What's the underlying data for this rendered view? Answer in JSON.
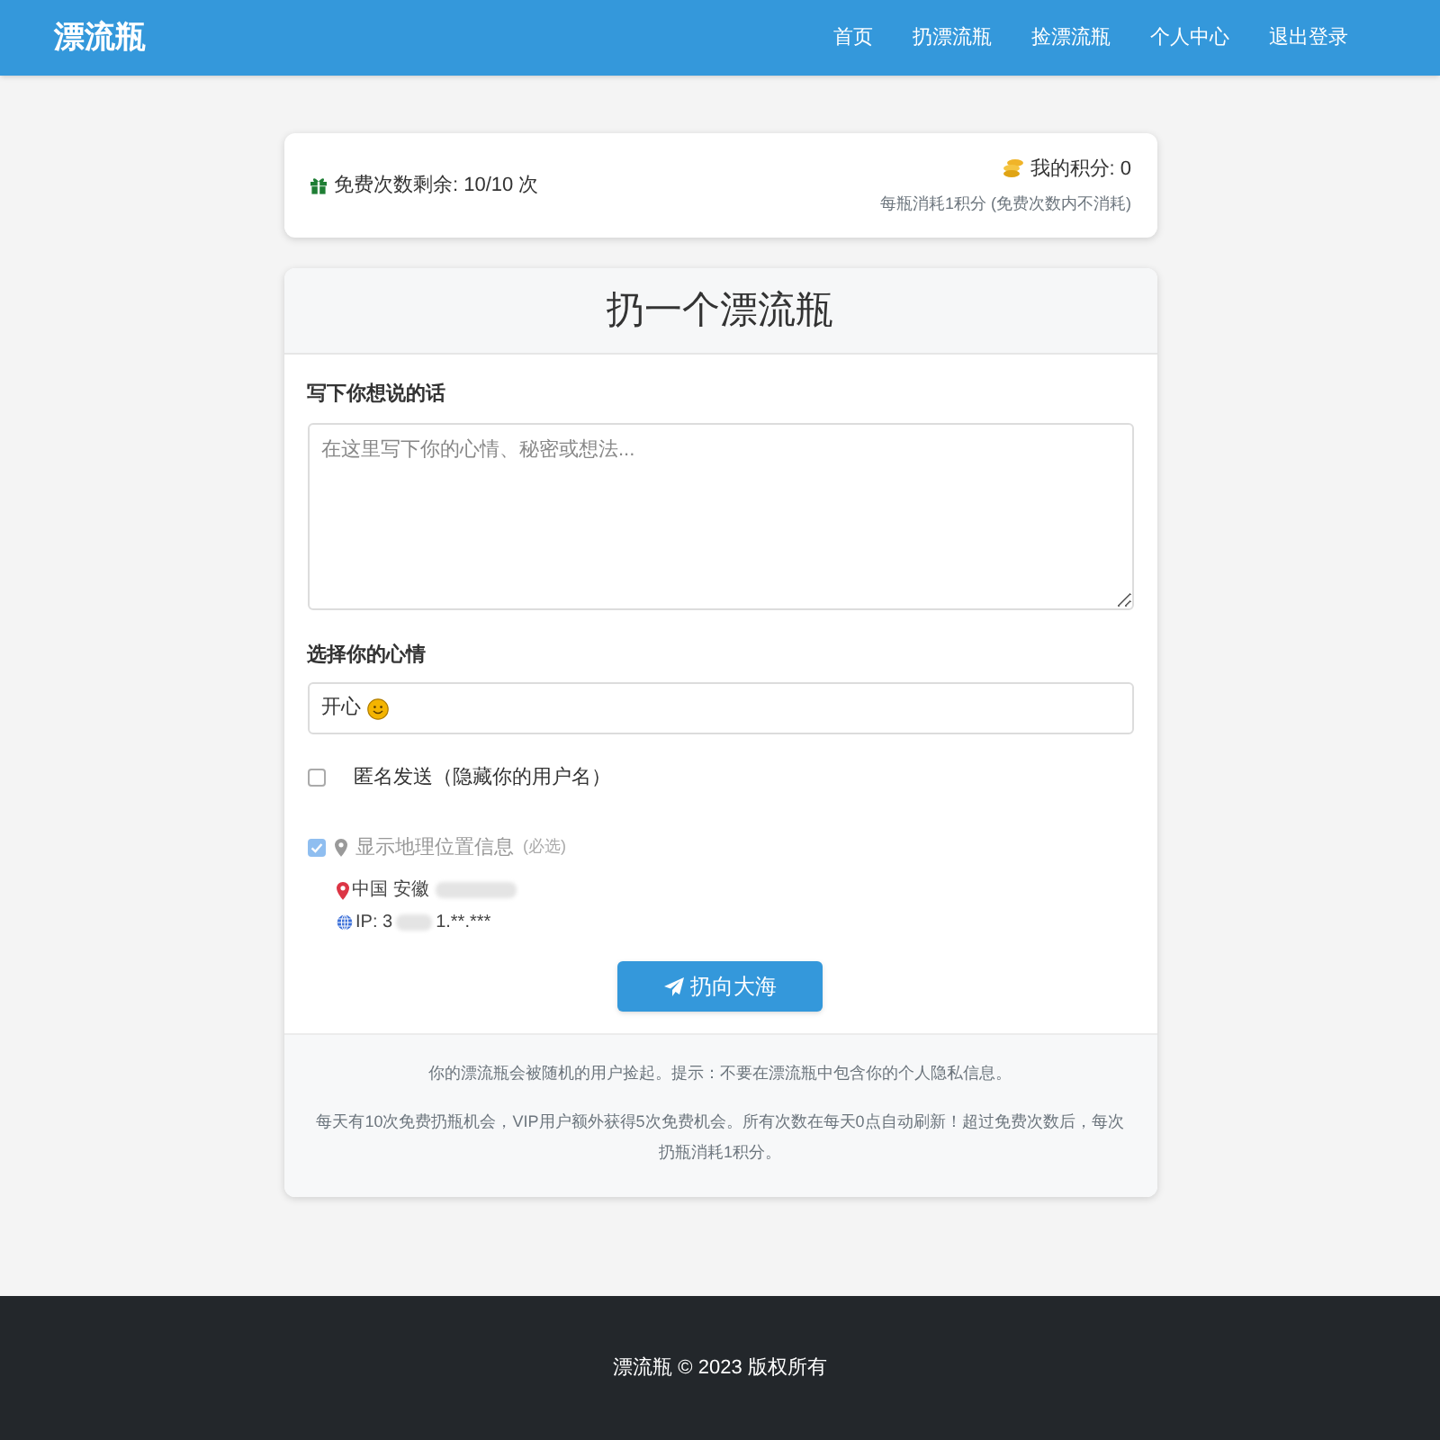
{
  "header": {
    "brand": "漂流瓶",
    "nav": [
      {
        "label": "首页"
      },
      {
        "label": "扔漂流瓶"
      },
      {
        "label": "捡漂流瓶"
      },
      {
        "label": "个人中心"
      },
      {
        "label": "退出登录"
      }
    ]
  },
  "quota_card": {
    "free_text": "免费次数剩余: 10/10 次",
    "points": "我的积分: 0",
    "points_note": "每瓶消耗1积分 (免费次数内不消耗)"
  },
  "form_card": {
    "title": "扔一个漂流瓶",
    "message": {
      "label": "写下你想说的话",
      "placeholder": "在这里写下你的心情、秘密或想法..."
    },
    "mood": {
      "label": "选择你的心情",
      "value": "开心"
    },
    "options": [
      {
        "kind": "plain",
        "label": "匿名发送（隐藏你的用户名）",
        "checked": false,
        "disabled": false
      },
      {
        "kind": "location",
        "label": "显示地理位置信息",
        "note": "(必选)",
        "checked": true,
        "disabled": true
      }
    ],
    "location": {
      "place": "中国 安徽",
      "ip_prefix": "IP: 3",
      "ip_suffix": "1.**.***"
    },
    "submit": "扔向大海",
    "notes": [
      "你的漂流瓶会被随机的用户捡起。提示：不要在漂流瓶中包含你的个人隐私信息。",
      "每天有10次免费扔瓶机会，VIP用户额外获得5次免费机会。所有次数在每天0点自动刷新！超过免费次数后，每次扔瓶消耗1积分。"
    ]
  },
  "footer": {
    "text": "漂流瓶 © 2023 版权所有"
  }
}
